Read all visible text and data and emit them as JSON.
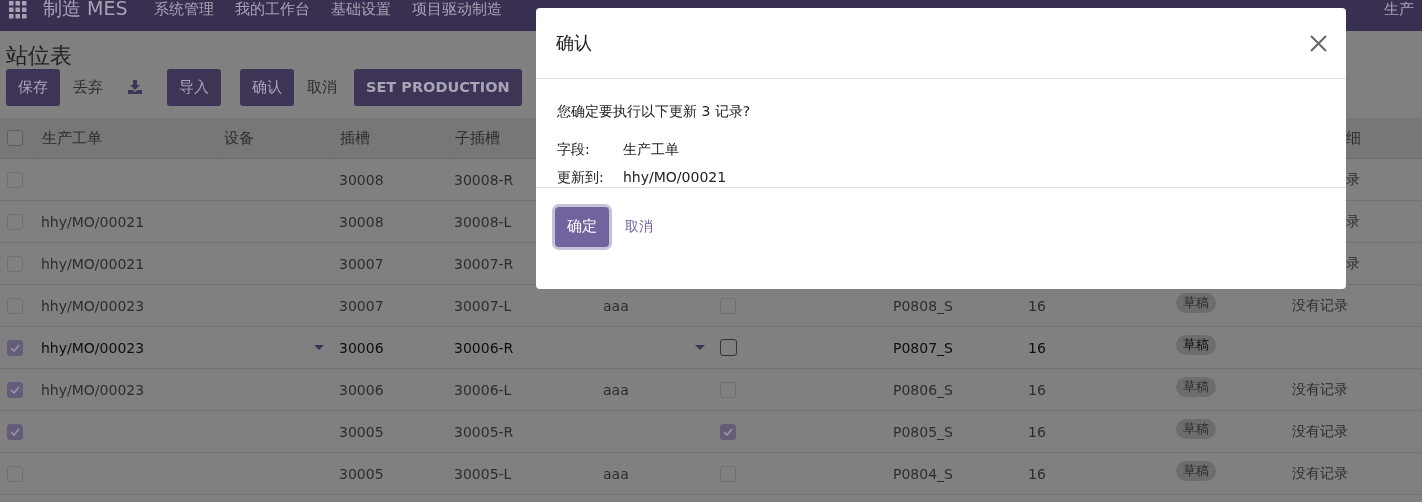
{
  "navbar": {
    "app_name": "制造 MES",
    "menu": [
      "系统管理",
      "我的工作台",
      "基础设置",
      "项目驱动制造"
    ],
    "menu_right": [
      "生产"
    ]
  },
  "page_title": "站位表",
  "toolbar": [
    {
      "kind": "button",
      "label": "保存"
    },
    {
      "kind": "link",
      "label": "丢弃"
    },
    {
      "kind": "download"
    },
    {
      "kind": "button",
      "label": "导入"
    },
    {
      "kind": "button",
      "label": "确认"
    },
    {
      "kind": "link",
      "label": "取消"
    },
    {
      "kind": "button",
      "label": "SET PRODUCTION"
    }
  ],
  "table": {
    "all_selected": false,
    "columns": [
      "生产工单",
      "设备",
      "插槽",
      "子插槽"
    ],
    "last_column": "细",
    "rows": [
      {
        "selected": false,
        "covered": true,
        "editing": false,
        "slot": "30008",
        "sub_slot": "30008-R",
        "details": "录"
      },
      {
        "selected": false,
        "covered": true,
        "editing": false,
        "work_order": "hhy/MO/00021",
        "slot": "30008",
        "sub_slot": "30008-L",
        "details": "录"
      },
      {
        "selected": false,
        "covered": true,
        "editing": false,
        "work_order": "hhy/MO/00021",
        "slot": "30007",
        "sub_slot": "30007-R",
        "details": "录"
      },
      {
        "selected": false,
        "covered": false,
        "editing": false,
        "work_order": "hhy/MO/00023",
        "slot": "30007",
        "sub_slot": "30007-L",
        "column_6": "aaa",
        "flag": false,
        "column_8": "P0808_S",
        "column_9": "16",
        "status": "草稿",
        "details": "没有记录"
      },
      {
        "selected": true,
        "covered": false,
        "editing": true,
        "work_order": "hhy/MO/00023",
        "slot": "30006",
        "sub_slot": "30006-R",
        "flag": false,
        "column_8": "P0807_S",
        "column_9": "16",
        "status": "草稿"
      },
      {
        "selected": true,
        "covered": false,
        "editing": false,
        "work_order": "hhy/MO/00023",
        "slot": "30006",
        "sub_slot": "30006-L",
        "column_6": "aaa",
        "flag": false,
        "column_8": "P0806_S",
        "column_9": "16",
        "status": "草稿",
        "details": "没有记录"
      },
      {
        "selected": true,
        "covered": false,
        "editing": false,
        "slot": "30005",
        "sub_slot": "30005-R",
        "flag": true,
        "column_8": "P0805_S",
        "column_9": "16",
        "status": "草稿",
        "details": "没有记录"
      },
      {
        "selected": false,
        "covered": false,
        "editing": false,
        "slot": "30005",
        "sub_slot": "30005-L",
        "column_6": "aaa",
        "flag": false,
        "column_8": "P0804_S",
        "column_9": "16",
        "status": "草稿",
        "details": "没有记录"
      }
    ]
  },
  "dialog": {
    "title": "确认",
    "message": "您确定要执行以下更新 3 记录?",
    "fields": [
      {
        "label": "字段:",
        "value": "生产工单"
      },
      {
        "label": "更新到:",
        "value": "hhy/MO/00021"
      }
    ],
    "buttons": [
      {
        "kind": "primary",
        "label": "确定"
      },
      {
        "kind": "link",
        "label": "取消"
      }
    ]
  }
}
